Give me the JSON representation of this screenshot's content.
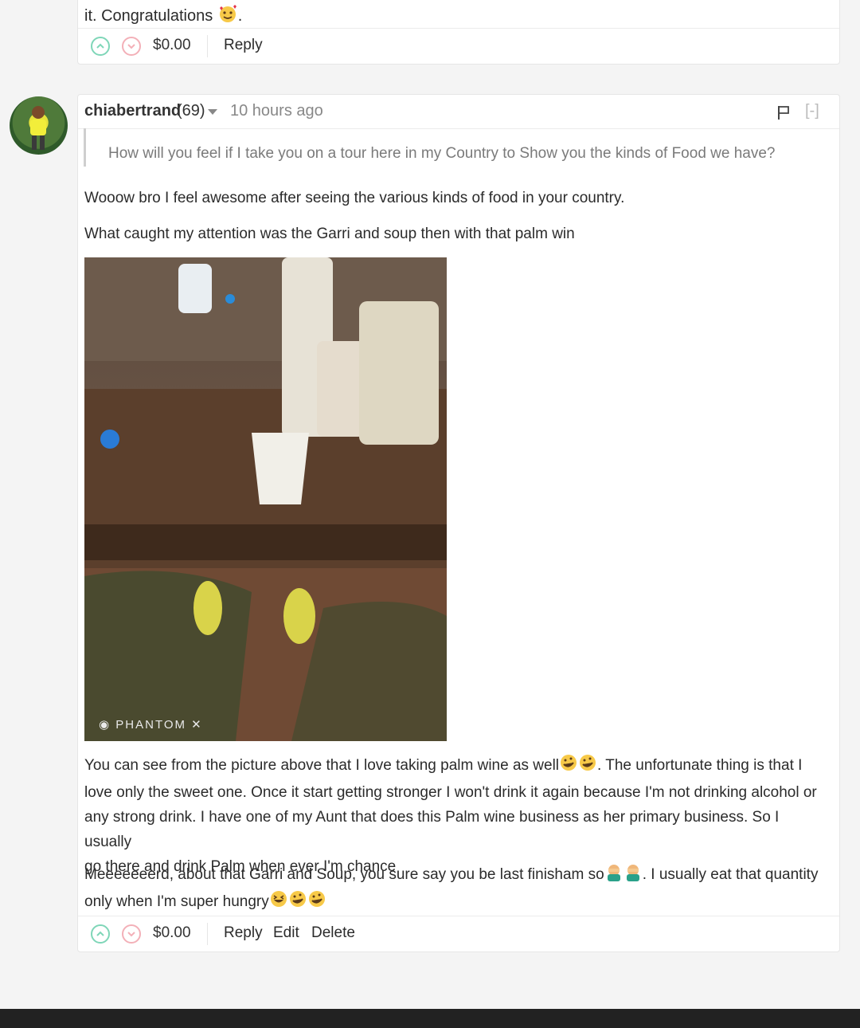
{
  "previous_comment": {
    "text_tail": "it. Congratulations",
    "text_end": ".",
    "payout": "$0.00",
    "actions": {
      "reply": "Reply"
    }
  },
  "comment": {
    "author": "chiabertrand",
    "reputation": "(69)",
    "time_ago": "10 hours ago",
    "collapse_label": "[-]",
    "quote": "How will you feel if I take you on a tour here in my Country to Show you the kinds of Food we have?",
    "paragraphs": [
      "Wooow bro I feel awesome after seeing the various kinds of food in your country.",
      "What caught my attention was the Garri and soup then with that palm win"
    ],
    "image_watermark": "PHANTOM",
    "paragraph3_lines": [
      "You can see from the picture above that I love taking palm wine as well",
      ". The unfortunate thing is that I",
      "love only the sweet one. Once it start getting stronger I won't drink it again because I'm not drinking alcohol or",
      "any strong drink. I have one of my Aunt that does this Palm wine business as her primary business. So I usually",
      "go there and drink Palm when ever I'm chance"
    ],
    "paragraph4_lines": [
      "Meeeeeeerd, about that Garri and Soup, you sure say you be last finisham so",
      ". I usually eat that quantity",
      "only when I'm super hungry"
    ],
    "payout": "$0.00",
    "actions": {
      "reply": "Reply",
      "edit": "Edit",
      "delete": "Delete"
    }
  },
  "colors": {
    "upvote": "#7fd6b8",
    "downvote": "#f3b0b8",
    "muted": "#888888"
  }
}
